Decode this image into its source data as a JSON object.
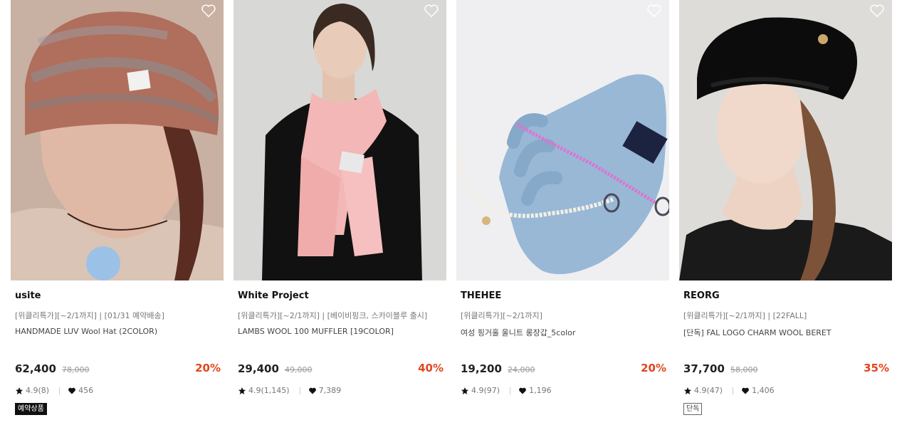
{
  "products": [
    {
      "brand": "usite",
      "promo": "[위클리특가][~2/1까지] | [01/31 예약배송]",
      "name": "HANDMADE LUV Wool Hat (2COLOR)",
      "price": "62,400",
      "original_price": "78,000",
      "discount": "20%",
      "rating": "4.9(8)",
      "likes": "456",
      "badge": "예약상품",
      "image_icon": "knit-bucket-hat-photo"
    },
    {
      "brand": "White Project",
      "promo": "[위클리특가][~2/1까지] | [베이비핑크, 스카이블루 출시]",
      "name": "LAMBS WOOL 100 MUFFLER [19COLOR]",
      "price": "29,400",
      "original_price": "49,000",
      "discount": "40%",
      "rating": "4.9(1,145)",
      "likes": "7,389",
      "badge": "",
      "image_icon": "pink-muffler-photo"
    },
    {
      "brand": "THEHEE",
      "promo": "[위클리특가][~2/1까지]",
      "name": "여성 핑거홀 울니트 롱장갑_5color",
      "price": "19,200",
      "original_price": "24,000",
      "discount": "20%",
      "rating": "4.9(97)",
      "likes": "1,196",
      "badge": "",
      "image_icon": "blue-gloves-photo"
    },
    {
      "brand": "REORG",
      "promo": "[위클리특가][~2/1까지] | [22FALL]",
      "name": "[단독] FAL LOGO CHARM WOOL BERET",
      "price": "37,700",
      "original_price": "58,000",
      "discount": "35%",
      "rating": "4.9(47)",
      "likes": "1,406",
      "badge": "단독",
      "image_icon": "black-beret-photo"
    }
  ],
  "colors": {
    "discount": "#e2461e",
    "badge_dark": "#111111"
  }
}
